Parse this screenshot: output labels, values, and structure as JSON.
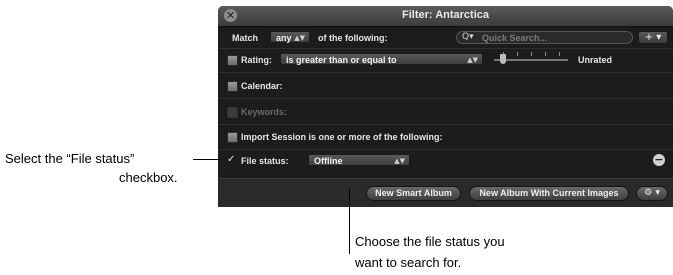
{
  "window": {
    "title": "Filter: Antarctica",
    "close_symbol": "✕"
  },
  "match_row": {
    "prefix": "Match",
    "mode": "any",
    "suffix": "of the following:",
    "search_placeholder": "Quick Search...",
    "search_icon_symbol": "Q▾",
    "add_button_symbol": "+ ▾"
  },
  "rating_row": {
    "label": "Rating:",
    "operator": "is greater than or equal to",
    "value_text": "Unrated"
  },
  "calendar_row": {
    "label": "Calendar:"
  },
  "keywords_row": {
    "label": "Keywords:"
  },
  "import_row": {
    "label": "Import Session is one or more of the following:"
  },
  "file_status_row": {
    "label": "File status:",
    "value": "Offline",
    "checked": true,
    "check_symbol": "✓",
    "remove_symbol": "−"
  },
  "popup_arrows": "▲▼",
  "bottom": {
    "new_smart_album": "New Smart Album",
    "new_album_current": "New Album With Current Images",
    "action_symbol": "⚙ ▾"
  },
  "callouts": {
    "left_line1": "Select the “File status”",
    "left_line2": "checkbox.",
    "bottom_line1": "Choose the file status you",
    "bottom_line2": "want to search for."
  }
}
